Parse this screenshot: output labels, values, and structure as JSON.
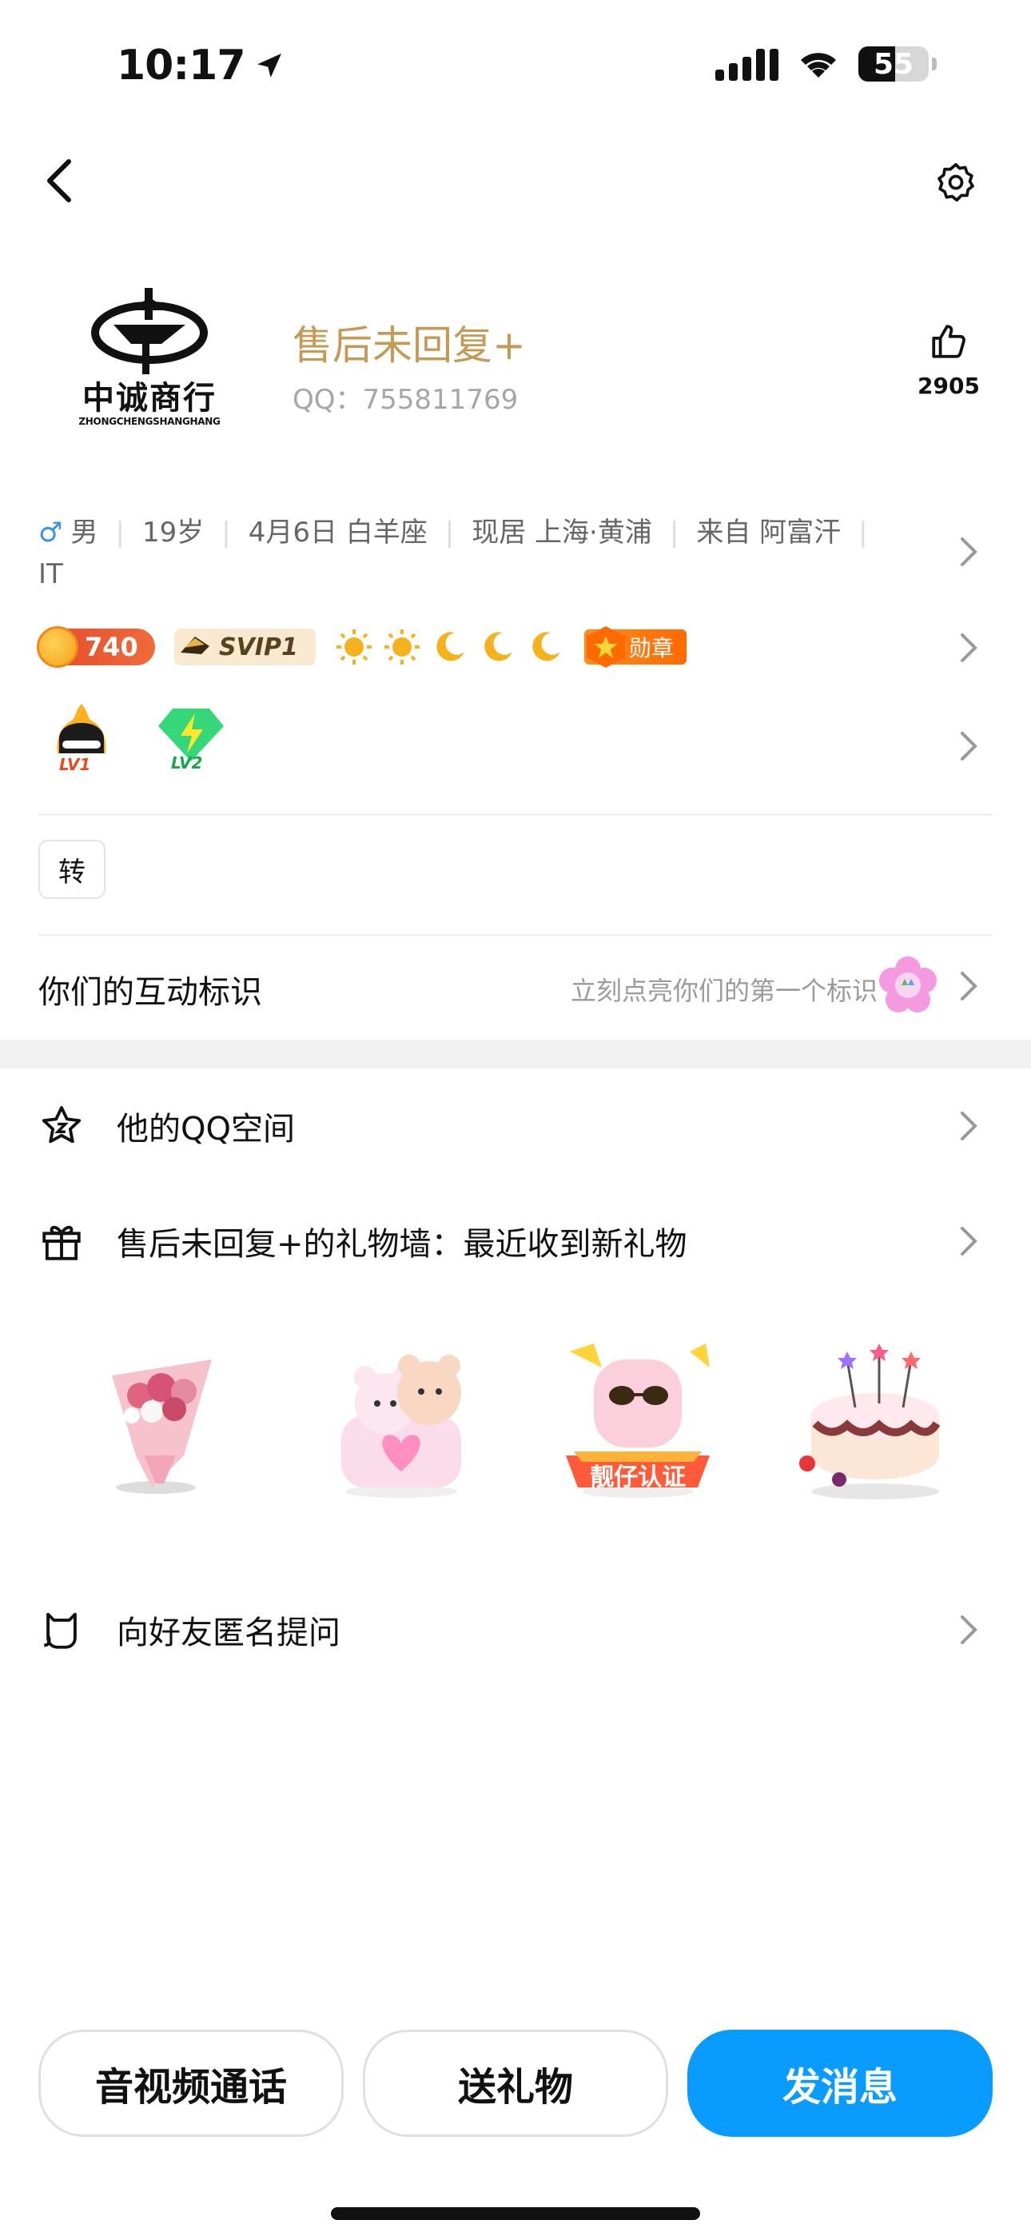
{
  "status_bar": {
    "time": "10:17",
    "battery": "55"
  },
  "profile": {
    "logo_text": "中诚商行",
    "logo_subtext": "ZHONGCHENGSHANGHANG",
    "nickname": "售后未回复+",
    "qq_id": "QQ：755811769",
    "like_count": "2905"
  },
  "info": {
    "gender": "男",
    "age": "19岁",
    "birthday": "4月6日 白羊座",
    "location": "现居 上海·黄浦",
    "hometown": "来自 阿富汗",
    "occupation": "IT"
  },
  "badges": {
    "coins": "740",
    "svip": "SVIP1",
    "medal": "勋章"
  },
  "levels": {
    "lv1": "LV1",
    "lv2": "LV2"
  },
  "tag_button": "转",
  "interaction": {
    "title": "你们的互动标识",
    "hint": "立刻点亮你们的第一个标识"
  },
  "list": {
    "qzone": "他的QQ空间",
    "gift_wall": "售后未回复+的礼物墙：最近收到新礼物",
    "anonymous": "向好友匿名提问"
  },
  "gifts": {
    "gift3_text": "靓仔认证"
  },
  "buttons": {
    "call": "音视频通话",
    "gift": "送礼物",
    "message": "发消息"
  },
  "colors": {
    "nickname": "#c49a55",
    "primary": "#0a9bff",
    "male": "#3b8ff0"
  }
}
